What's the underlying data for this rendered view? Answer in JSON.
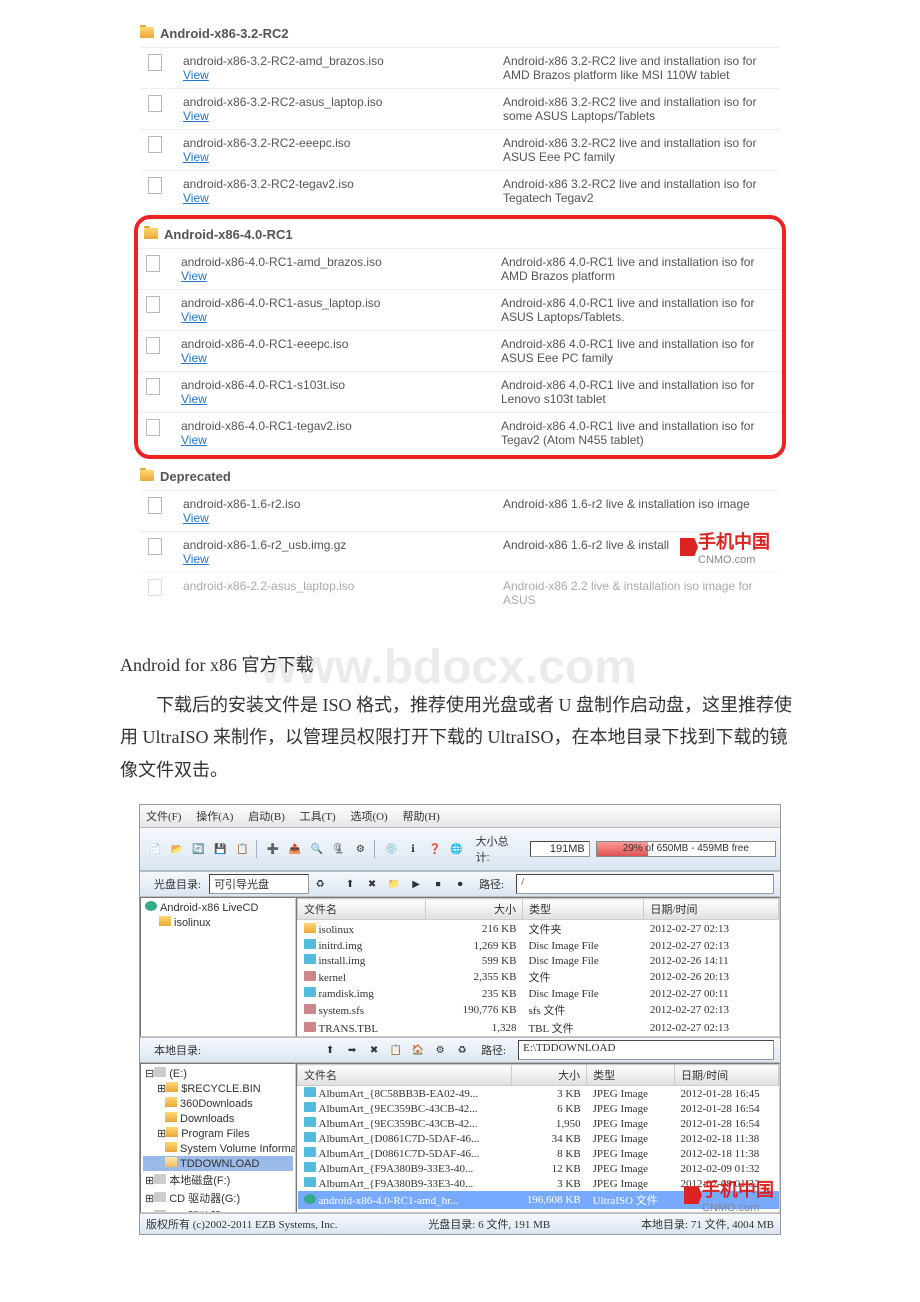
{
  "sections": {
    "s1": {
      "title": "Android-x86-3.2-RC2"
    },
    "s2": {
      "title": "Android-x86-4.0-RC1"
    },
    "s3": {
      "title": "Deprecated"
    }
  },
  "items": {
    "a1": {
      "name": "android-x86-3.2-RC2-amd_brazos.iso",
      "view": "View",
      "desc": "Android-x86 3.2-RC2 live and installation iso for AMD Brazos platform like MSI 110W tablet"
    },
    "a2": {
      "name": "android-x86-3.2-RC2-asus_laptop.iso",
      "view": "View",
      "desc": "Android-x86 3.2-RC2 live and installation iso for some ASUS Laptops/Tablets"
    },
    "a3": {
      "name": "android-x86-3.2-RC2-eeepc.iso",
      "view": "View",
      "desc": "Android-x86 3.2-RC2 live and installation iso for ASUS Eee PC family"
    },
    "a4": {
      "name": "android-x86-3.2-RC2-tegav2.iso",
      "view": "View",
      "desc": "Android-x86 3.2-RC2 live and installation iso for Tegatech Tegav2"
    },
    "b1": {
      "name": "android-x86-4.0-RC1-amd_brazos.iso",
      "view": "View",
      "desc": "Android-x86 4.0-RC1 live and installation iso for AMD Brazos platform"
    },
    "b2": {
      "name": "android-x86-4.0-RC1-asus_laptop.iso",
      "view": "View",
      "desc": "Android-x86 4.0-RC1 live and installation iso for ASUS Laptops/Tablets."
    },
    "b3": {
      "name": "android-x86-4.0-RC1-eeepc.iso",
      "view": "View",
      "desc": "Android-x86 4.0-RC1 live and installation iso for ASUS Eee PC family"
    },
    "b4": {
      "name": "android-x86-4.0-RC1-s103t.iso",
      "view": "View",
      "desc": "Android-x86 4.0-RC1 live and installation iso for Lenovo s103t tablet"
    },
    "b5": {
      "name": "android-x86-4.0-RC1-tegav2.iso",
      "view": "View",
      "desc": "Android-x86 4.0-RC1 live and installation iso for Tegav2 (Atom N455 tablet)"
    },
    "c1": {
      "name": "android-x86-1.6-r2.iso",
      "view": "View",
      "desc": "Android-x86 1.6-r2 live & installation iso image"
    },
    "c2": {
      "name": "android-x86-1.6-r2_usb.img.gz",
      "view": "View",
      "desc": "Android-x86 1.6-r2 live & install"
    },
    "c3": {
      "name": "android-x86-2.2-asus_laptop.iso",
      "desc": "Android-x86 2.2 live & installation iso image for ASUS"
    }
  },
  "caption": "Android for x86 官方下载",
  "para": "下载后的安装文件是 ISO 格式，推荐使用光盘或者 U 盘制作启动盘，这里推荐使用 UltraISO 来制作，以管理员权限打开下载的 UltraISO，在本地目录下找到下载的镜像文件双击。",
  "watermark": "www.bdocx.com",
  "logo": {
    "text": "手机中国",
    "sub": "CNMO.com"
  },
  "app": {
    "menus": {
      "m1": "文件(F)",
      "m2": "操作(A)",
      "m3": "启动(B)",
      "m4": "工具(T)",
      "m5": "选项(O)",
      "m6": "帮助(H)"
    },
    "top_stat": {
      "lbl": "大小总计:",
      "val": "191MB",
      "usage": "29% of 650MB - 459MB free"
    },
    "disc_bar": {
      "lbl": "光盘目录:",
      "val": "可引导光盘",
      "path_lbl": "路径:",
      "path": "/"
    },
    "tree1": {
      "root": "Android-x86 LiveCD",
      "c1": "isolinux"
    },
    "cols": {
      "c1": "文件名",
      "c2": "大小",
      "c3": "类型",
      "c4": "日期/时间"
    },
    "rows1": [
      {
        "n": "isolinux",
        "s": "216 KB",
        "t": "文件夹",
        "d": "2012-02-27 02:13"
      },
      {
        "n": "initrd.img",
        "s": "1,269 KB",
        "t": "Disc Image File",
        "d": "2012-02-27 02:13"
      },
      {
        "n": "install.img",
        "s": "599 KB",
        "t": "Disc Image File",
        "d": "2012-02-26 14:11"
      },
      {
        "n": "kernel",
        "s": "2,355 KB",
        "t": "文件",
        "d": "2012-02-26 20:13"
      },
      {
        "n": "ramdisk.img",
        "s": "235 KB",
        "t": "Disc Image File",
        "d": "2012-02-27 00:11"
      },
      {
        "n": "system.sfs",
        "s": "190,776 KB",
        "t": "sfs 文件",
        "d": "2012-02-27 02:13"
      },
      {
        "n": "TRANS.TBL",
        "s": "1,328",
        "t": "TBL 文件",
        "d": "2012-02-27 02:13"
      }
    ],
    "local_bar": {
      "lbl": "本地目录:",
      "path_lbl": "路径:",
      "path": "E:\\TDDOWNLOAD"
    },
    "tree2": {
      "root": "(E:)",
      "i1": "$RECYCLE.BIN",
      "i2": "360Downloads",
      "i3": "Downloads",
      "i4": "Program Files",
      "i5": "System Volume Informat",
      "i6": "TDDOWNLOAD",
      "i7": "本地磁盘(F:)",
      "i8": "CD 驱动器(G:)",
      "i9": "CD 驱动器(I:)"
    },
    "rows2": [
      {
        "n": "AlbumArt_{8C58BB3B-EA02-49...",
        "s": "3 KB",
        "t": "JPEG Image",
        "d": "2012-01-28 16:45"
      },
      {
        "n": "AlbumArt_{9EC359BC-43CB-42...",
        "s": "6 KB",
        "t": "JPEG Image",
        "d": "2012-01-28 16:54"
      },
      {
        "n": "AlbumArt_{9EC359BC-43CB-42...",
        "s": "1,950",
        "t": "JPEG Image",
        "d": "2012-01-28 16:54"
      },
      {
        "n": "AlbumArt_{D0861C7D-5DAF-46...",
        "s": "34 KB",
        "t": "JPEG Image",
        "d": "2012-02-18 11:38"
      },
      {
        "n": "AlbumArt_{D0861C7D-5DAF-46...",
        "s": "8 KB",
        "t": "JPEG Image",
        "d": "2012-02-18 11:38"
      },
      {
        "n": "AlbumArt_{F9A380B9-33E3-40...",
        "s": "12 KB",
        "t": "JPEG Image",
        "d": "2012-02-09 01:32"
      },
      {
        "n": "AlbumArt_{F9A380B9-33E3-40...",
        "s": "3 KB",
        "t": "JPEG Image",
        "d": "2012-02-09 01:32"
      },
      {
        "n": "android-x86-4.0-RC1-amd_br...",
        "s": "196,608 KB",
        "t": "UltraISO 文件",
        "d": ""
      }
    ],
    "footer": {
      "copy": "版权所有 (c)2002-2011 EZB Systems, Inc.",
      "mid": "光盘目录: 6 文件, 191 MB",
      "right": "本地目录: 71 文件, 4004 MB"
    }
  }
}
